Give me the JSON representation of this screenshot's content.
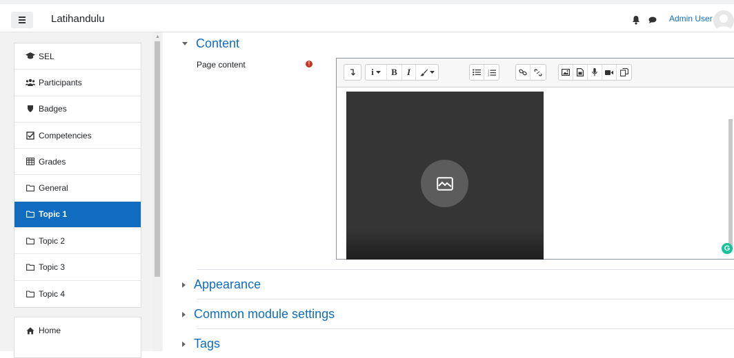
{
  "navbar": {
    "site_name": "Latihandulu",
    "user_name": "Admin User",
    "menu_icon": "hamburger-icon",
    "bell_icon": "bell-icon",
    "messages_icon": "chat-icon"
  },
  "sidebar": {
    "items": [
      {
        "label": "SEL",
        "icon": "graduation-cap-icon"
      },
      {
        "label": "Participants",
        "icon": "users-icon"
      },
      {
        "label": "Badges",
        "icon": "shield-icon"
      },
      {
        "label": "Competencies",
        "icon": "check-square-icon"
      },
      {
        "label": "Grades",
        "icon": "table-icon"
      },
      {
        "label": "General",
        "icon": "folder-icon"
      },
      {
        "label": "Topic 1",
        "icon": "folder-icon",
        "active": true
      },
      {
        "label": "Topic 2",
        "icon": "folder-icon"
      },
      {
        "label": "Topic 3",
        "icon": "folder-icon"
      },
      {
        "label": "Topic 4",
        "icon": "folder-icon"
      }
    ],
    "home": {
      "label": "Home",
      "icon": "home-icon"
    }
  },
  "main": {
    "content_section": "Content",
    "page_content_label": "Page content",
    "toolbar": {
      "buttons": [
        "collapse-icon",
        "info-dropdown",
        "bold",
        "italic",
        "brush-dropdown",
        "unordered-list-icon",
        "ordered-list-icon",
        "link-icon",
        "unlink-icon",
        "image-icon",
        "media-icon",
        "record-audio-icon",
        "record-video-icon",
        "manage-files-icon"
      ],
      "bold_label": "B",
      "italic_label": "I",
      "info_label": "i"
    },
    "grammarly_label": "G",
    "sections": [
      "Appearance",
      "Common module settings",
      "Tags"
    ]
  },
  "colors": {
    "accent": "#0f6cbf",
    "active_bg": "#0f6cbf",
    "required": "#ca3120"
  }
}
